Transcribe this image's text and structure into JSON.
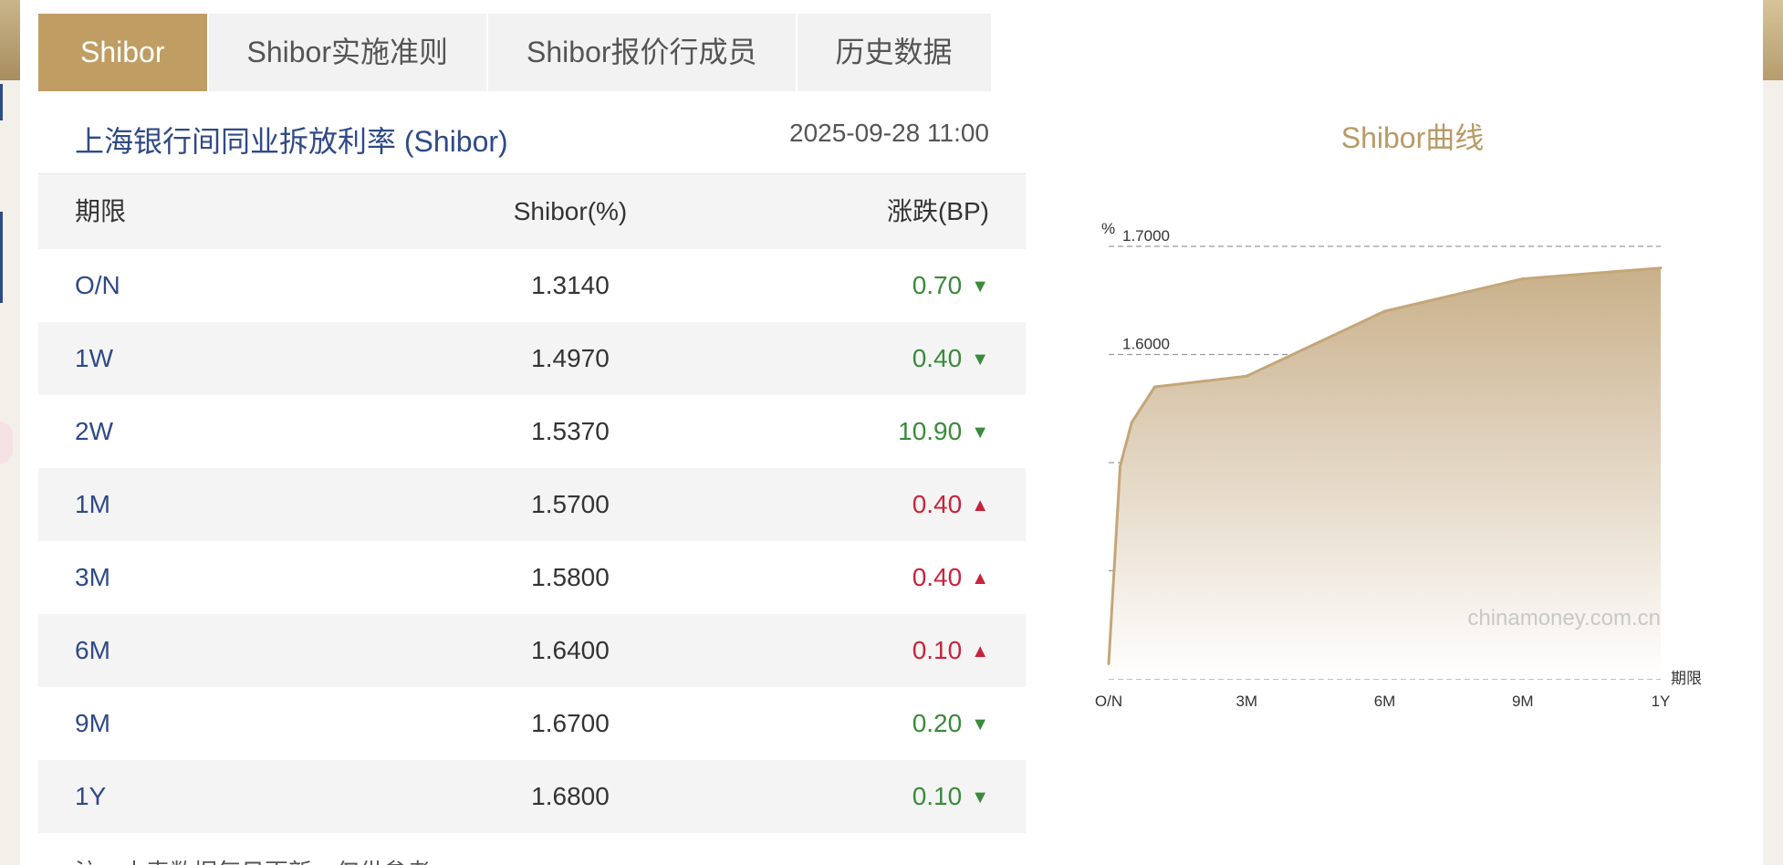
{
  "tabs": [
    {
      "label": "Shibor",
      "active": true
    },
    {
      "label": "Shibor实施准则",
      "active": false
    },
    {
      "label": "Shibor报价行成员",
      "active": false
    },
    {
      "label": "历史数据",
      "active": false
    }
  ],
  "table": {
    "title": "上海银行间同业拆放利率 (Shibor)",
    "datetime": "2025-09-28 11:00",
    "columns": [
      "期限",
      "Shibor(%)",
      "涨跌(BP)"
    ],
    "rows": [
      {
        "term": "O/N",
        "rate": "1.3140",
        "change": "0.70",
        "direction": "down"
      },
      {
        "term": "1W",
        "rate": "1.4970",
        "change": "0.40",
        "direction": "down"
      },
      {
        "term": "2W",
        "rate": "1.5370",
        "change": "10.90",
        "direction": "down"
      },
      {
        "term": "1M",
        "rate": "1.5700",
        "change": "0.40",
        "direction": "up"
      },
      {
        "term": "3M",
        "rate": "1.5800",
        "change": "0.40",
        "direction": "up"
      },
      {
        "term": "6M",
        "rate": "1.6400",
        "change": "0.10",
        "direction": "up"
      },
      {
        "term": "9M",
        "rate": "1.6700",
        "change": "0.20",
        "direction": "down"
      },
      {
        "term": "1Y",
        "rate": "1.6800",
        "change": "0.10",
        "direction": "down"
      }
    ],
    "note": "注：本表数据每日更新，仅供参考。"
  },
  "colors": {
    "accent": "#bf9d63",
    "link": "#2f4a86",
    "up": "#c8233c",
    "down": "#3a8a3a"
  },
  "icons": {
    "up": "triangle-up-icon",
    "down": "triangle-down-icon"
  },
  "chart_data": {
    "type": "area",
    "title": "Shibor曲线",
    "ylabel": "%",
    "xlabel": "期限",
    "watermark": "chinamoney.com.cn",
    "categories": [
      "O/N",
      "1W",
      "2W",
      "1M",
      "3M",
      "6M",
      "9M",
      "1Y"
    ],
    "x_months": [
      0,
      0.25,
      0.5,
      1,
      3,
      6,
      9,
      12
    ],
    "x_ticks": [
      "O/N",
      "3M",
      "6M",
      "9M",
      "1Y"
    ],
    "x_tick_months": [
      0,
      3,
      6,
      9,
      12
    ],
    "values": [
      1.314,
      1.497,
      1.537,
      1.57,
      1.58,
      1.64,
      1.67,
      1.68
    ],
    "ylim": [
      1.3,
      1.7
    ],
    "yticks": [
      "1.3000",
      "1.4000",
      "1.5000",
      "1.6000",
      "1.7000"
    ],
    "grid": true
  }
}
